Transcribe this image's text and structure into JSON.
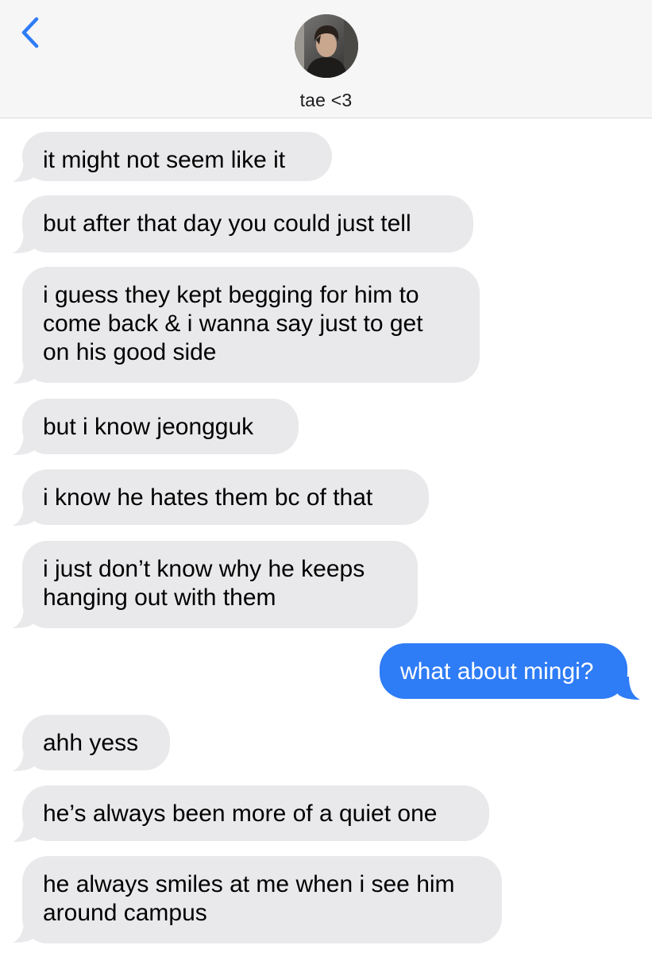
{
  "header": {
    "contact_name": "tae <3",
    "back_icon": "chevron-left-icon",
    "avatar_icon": "contact-avatar"
  },
  "colors": {
    "accent": "#2e7cf6",
    "received_bubble": "#e9e9eb",
    "header_bg": "#f6f6f7"
  },
  "messages": [
    {
      "direction": "received",
      "lines": [
        "it might not seem like it"
      ]
    },
    {
      "direction": "received",
      "lines": [
        "but after that day you could just tell"
      ]
    },
    {
      "direction": "received",
      "lines": [
        "i guess they kept begging for him to",
        "come back & i wanna say just to get",
        "on his good side"
      ]
    },
    {
      "direction": "received",
      "lines": [
        "but i know jeongguk"
      ]
    },
    {
      "direction": "received",
      "lines": [
        "i know he hates them bc of that"
      ]
    },
    {
      "direction": "received",
      "lines": [
        "i just don’t know why he keeps",
        "hanging out with them"
      ]
    },
    {
      "direction": "sent",
      "lines": [
        "what about mingi?"
      ]
    },
    {
      "direction": "received",
      "lines": [
        "ahh yess"
      ]
    },
    {
      "direction": "received",
      "lines": [
        "he’s always been more of a quiet one"
      ]
    },
    {
      "direction": "received",
      "lines": [
        "he always smiles at me when i see him",
        "around campus"
      ]
    }
  ]
}
